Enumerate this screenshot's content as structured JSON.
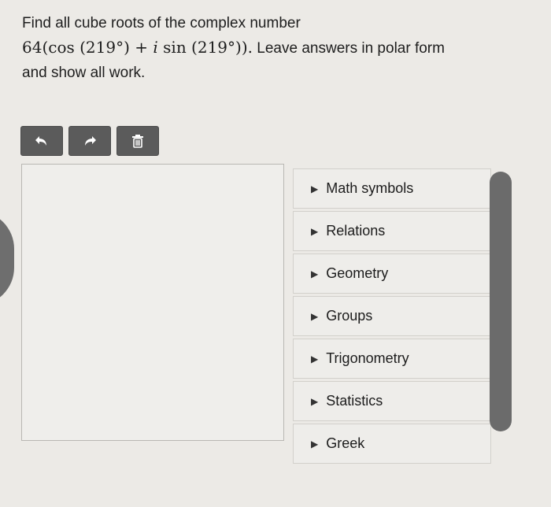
{
  "question": {
    "line1": "Find all cube roots of the complex number",
    "math": {
      "coef": "64",
      "open": "(cos (",
      "angle1": "219",
      "mid": "°) + ",
      "i": "i",
      "sin": " sin (",
      "angle2": "219",
      "close": "°))."
    },
    "line2_rest": " Leave answers in polar form",
    "line3": "and show all work."
  },
  "toolbar": {
    "undo_icon": "undo-icon",
    "redo_icon": "redo-icon",
    "delete_icon": "trash-icon"
  },
  "palette": {
    "items": [
      "Math symbols",
      "Relations",
      "Geometry",
      "Groups",
      "Trigonometry",
      "Statistics",
      "Greek"
    ]
  },
  "colors": {
    "toolbar_button": "#5b5b5b",
    "scrollbar": "#6b6b6b",
    "background": "#eceae6"
  }
}
